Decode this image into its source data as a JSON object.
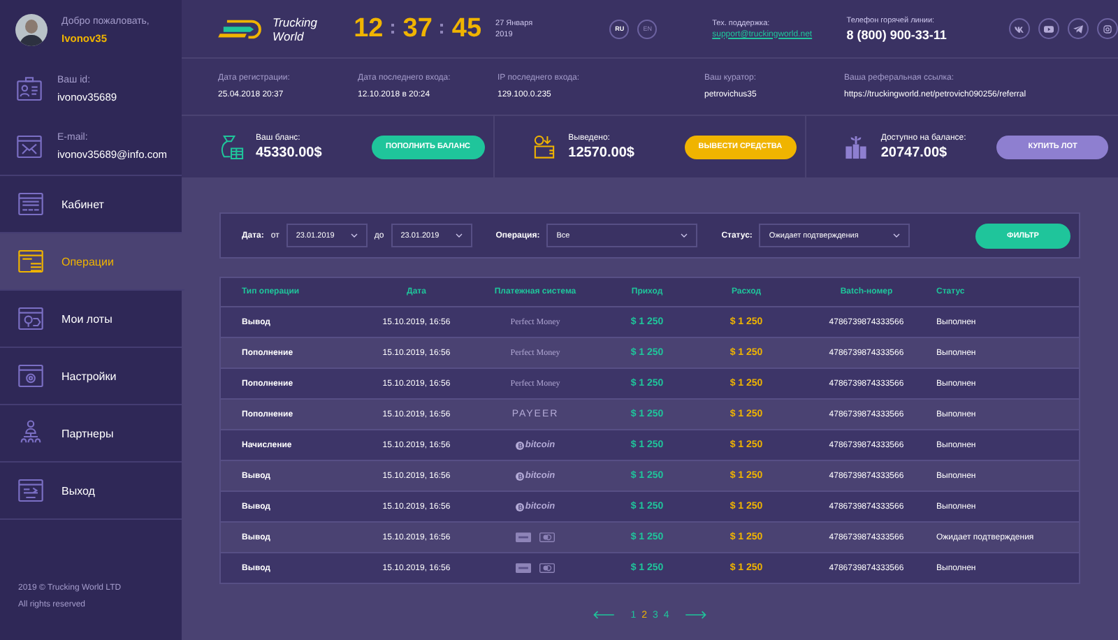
{
  "profile": {
    "greeting": "Добро пожаловать,",
    "username": "Ivonov35",
    "id_label": "Ваш id:",
    "id_value": "ivonov35689",
    "email_label": "E-mail:",
    "email_value": "ivonov35689@info.com"
  },
  "sidebar": {
    "items": [
      {
        "label": "Кабинет",
        "selected": false
      },
      {
        "label": "Операции",
        "selected": true
      },
      {
        "label": "Мои лоты",
        "selected": false
      },
      {
        "label": "Настройки",
        "selected": false
      },
      {
        "label": "Партнеры",
        "selected": false
      },
      {
        "label": "Выход",
        "selected": false
      }
    ],
    "footer": [
      "2019 © Trucking World LTD",
      "All rights reserved"
    ]
  },
  "header": {
    "logo": [
      "Trucking",
      "World"
    ],
    "clock": [
      "12",
      "37",
      "45"
    ],
    "date": [
      "27 Января",
      "2019"
    ],
    "languages": [
      {
        "label": "RU",
        "selected": true
      },
      {
        "label": "EN",
        "selected": false
      }
    ],
    "support_label": "Тех. поддержка:",
    "support_email": "support@truckingworld.net",
    "phone_label": "Телефон горячей линии:",
    "phone": "8 (800) 900-33-11"
  },
  "info": [
    {
      "label": "Дата регистрации:",
      "value": "25.04.2018  20:37"
    },
    {
      "label": "Дата последнего входа:",
      "value": "12.10.2018 в 20:24"
    },
    {
      "label": "IP последнего входа:",
      "value": "129.100.0.235"
    },
    {
      "label": "Ваш куратор:",
      "value": "petrovichus35"
    },
    {
      "label": "Ваша реферальная ссылка:",
      "value": "https://truckingworld.net/petrovich090256/referral"
    }
  ],
  "balances": [
    {
      "kind": "balance",
      "label": "Ваш бланс:",
      "amount": "45330.00$",
      "button": "ПОПОЛНИТЬ БАЛАНС"
    },
    {
      "kind": "withdrawn",
      "label": "Выведено:",
      "amount": "12570.00$",
      "button": "ВЫВЕСТИ СРЕДСТВА"
    },
    {
      "kind": "available",
      "label": "Доступно на балансе:",
      "amount": "20747.00$",
      "button": "КУПИТЬ ЛОТ"
    }
  ],
  "filter": {
    "date_label": "Дата:",
    "from_label": "от",
    "from": "23.01.2019",
    "to_label": "до",
    "to": "23.01.2019",
    "operation_label": "Операция:",
    "operation": "Все",
    "status_label": "Статус:",
    "status": "Ожидает подтверждения",
    "button": "ФИЛЬТР"
  },
  "table": {
    "columns": [
      "Тип операции",
      "Дата",
      "Платежная система",
      "Приход",
      "Расход",
      "Batch-номер",
      "Статус"
    ],
    "rows": [
      {
        "type": "Вывод",
        "date": "15.10.2019, 16:56",
        "system": {
          "kind": "perfect_money",
          "text": "Perfect Money"
        },
        "income": "$ 1 250",
        "expense": "$ 1 250",
        "batch": "4786739874333566",
        "status": "Выполнен"
      },
      {
        "type": "Пополнение",
        "date": "15.10.2019, 16:56",
        "system": {
          "kind": "perfect_money",
          "text": "Perfect Money"
        },
        "income": "$ 1 250",
        "expense": "$ 1 250",
        "batch": "4786739874333566",
        "status": "Выполнен"
      },
      {
        "type": "Пополнение",
        "date": "15.10.2019, 16:56",
        "system": {
          "kind": "perfect_money",
          "text": "Perfect Money"
        },
        "income": "$ 1 250",
        "expense": "$ 1 250",
        "batch": "4786739874333566",
        "status": "Выполнен"
      },
      {
        "type": "Пополнение",
        "date": "15.10.2019, 16:56",
        "system": {
          "kind": "payeer",
          "text": "PAYEER"
        },
        "income": "$ 1 250",
        "expense": "$ 1 250",
        "batch": "4786739874333566",
        "status": "Выполнен"
      },
      {
        "type": "Начисление",
        "date": "15.10.2019, 16:56",
        "system": {
          "kind": "bitcoin",
          "text": "bitcoin"
        },
        "income": "$ 1 250",
        "expense": "$ 1 250",
        "batch": "4786739874333566",
        "status": "Выполнен"
      },
      {
        "type": "Вывод",
        "date": "15.10.2019, 16:56",
        "system": {
          "kind": "bitcoin",
          "text": "bitcoin"
        },
        "income": "$ 1 250",
        "expense": "$ 1 250",
        "batch": "4786739874333566",
        "status": "Выполнен"
      },
      {
        "type": "Вывод",
        "date": "15.10.2019, 16:56",
        "system": {
          "kind": "bitcoin",
          "text": "bitcoin"
        },
        "income": "$ 1 250",
        "expense": "$ 1 250",
        "batch": "4786739874333566",
        "status": "Выполнен"
      },
      {
        "type": "Вывод",
        "date": "15.10.2019, 16:56",
        "system": {
          "kind": "cards"
        },
        "income": "$ 1 250",
        "expense": "$ 1 250",
        "batch": "4786739874333566",
        "status": "Ожидает подтверждения"
      },
      {
        "type": "Вывод",
        "date": "15.10.2019, 16:56",
        "system": {
          "kind": "cards"
        },
        "income": "$ 1 250",
        "expense": "$ 1 250",
        "batch": "4786739874333566",
        "status": "Выполнен"
      }
    ]
  },
  "pagination": [
    {
      "label": "1",
      "selected": false
    },
    {
      "label": "2",
      "selected": true
    },
    {
      "label": "3",
      "selected": false
    },
    {
      "label": "4",
      "selected": false
    }
  ]
}
